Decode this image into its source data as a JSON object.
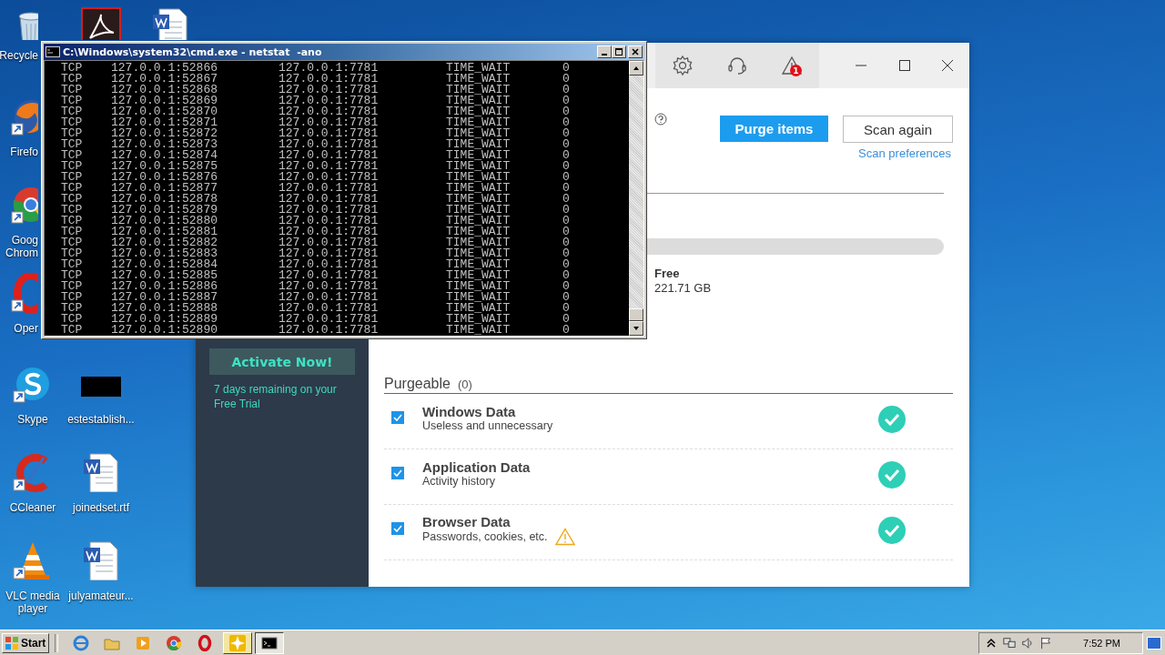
{
  "desktop": {
    "icons": [
      {
        "kind": "recycle",
        "label": "Recycle",
        "shortcut": false
      },
      {
        "kind": "acrobat",
        "shortcut": false
      },
      {
        "kind": "word",
        "shortcut": false
      },
      {
        "kind": "firefox",
        "label": "Firefo",
        "shortcut": true
      },
      {
        "kind": "chrome",
        "label": "Goog Chrom",
        "shortcut": true
      },
      {
        "kind": "opera",
        "label": "Oper",
        "shortcut": true
      },
      {
        "kind": "skype",
        "label": "Skype",
        "shortcut": true
      },
      {
        "kind": "blank",
        "label": "estestablish...",
        "shortcut": false
      },
      {
        "kind": "ccleaner",
        "label": "CCleaner",
        "shortcut": true
      },
      {
        "kind": "word",
        "label": "joinedset.rtf",
        "shortcut": false
      },
      {
        "kind": "vlc",
        "label": "VLC media player",
        "shortcut": true
      },
      {
        "kind": "word",
        "label": "julyamateur...",
        "shortcut": false
      }
    ]
  },
  "app": {
    "toolbar": {
      "alert_badge": "1"
    },
    "purge_button": "Purge items",
    "scan_button": "Scan again",
    "scan_preferences": "Scan preferences",
    "disk": {
      "free_label": "Free",
      "free_value": "221.71 GB"
    },
    "sidebar": {
      "activate_button": "Activate Now!",
      "trial_text": "7 days remaining on your Free Trial"
    },
    "purgeable": {
      "title": "Purgeable",
      "count": "(0)",
      "items": [
        {
          "title": "Windows Data",
          "subtitle": "Useless and unnecessary",
          "checked": true,
          "warning": false,
          "done": true
        },
        {
          "title": "Application Data",
          "subtitle": "Activity history",
          "checked": true,
          "warning": false,
          "done": true
        },
        {
          "title": "Browser Data",
          "subtitle": "Passwords, cookies, etc.",
          "checked": true,
          "warning": true,
          "done": true
        }
      ]
    }
  },
  "cmd": {
    "title": "C:\\Windows\\system32\\cmd.exe - netstat  -ano",
    "rows": [
      {
        "proto": "TCP",
        "local": "127.0.0.1:52866",
        "foreign": "127.0.0.1:7781",
        "state": "TIME_WAIT",
        "pid": "0"
      },
      {
        "proto": "TCP",
        "local": "127.0.0.1:52867",
        "foreign": "127.0.0.1:7781",
        "state": "TIME_WAIT",
        "pid": "0"
      },
      {
        "proto": "TCP",
        "local": "127.0.0.1:52868",
        "foreign": "127.0.0.1:7781",
        "state": "TIME_WAIT",
        "pid": "0"
      },
      {
        "proto": "TCP",
        "local": "127.0.0.1:52869",
        "foreign": "127.0.0.1:7781",
        "state": "TIME_WAIT",
        "pid": "0"
      },
      {
        "proto": "TCP",
        "local": "127.0.0.1:52870",
        "foreign": "127.0.0.1:7781",
        "state": "TIME_WAIT",
        "pid": "0"
      },
      {
        "proto": "TCP",
        "local": "127.0.0.1:52871",
        "foreign": "127.0.0.1:7781",
        "state": "TIME_WAIT",
        "pid": "0"
      },
      {
        "proto": "TCP",
        "local": "127.0.0.1:52872",
        "foreign": "127.0.0.1:7781",
        "state": "TIME_WAIT",
        "pid": "0"
      },
      {
        "proto": "TCP",
        "local": "127.0.0.1:52873",
        "foreign": "127.0.0.1:7781",
        "state": "TIME_WAIT",
        "pid": "0"
      },
      {
        "proto": "TCP",
        "local": "127.0.0.1:52874",
        "foreign": "127.0.0.1:7781",
        "state": "TIME_WAIT",
        "pid": "0"
      },
      {
        "proto": "TCP",
        "local": "127.0.0.1:52875",
        "foreign": "127.0.0.1:7781",
        "state": "TIME_WAIT",
        "pid": "0"
      },
      {
        "proto": "TCP",
        "local": "127.0.0.1:52876",
        "foreign": "127.0.0.1:7781",
        "state": "TIME_WAIT",
        "pid": "0"
      },
      {
        "proto": "TCP",
        "local": "127.0.0.1:52877",
        "foreign": "127.0.0.1:7781",
        "state": "TIME_WAIT",
        "pid": "0"
      },
      {
        "proto": "TCP",
        "local": "127.0.0.1:52878",
        "foreign": "127.0.0.1:7781",
        "state": "TIME_WAIT",
        "pid": "0"
      },
      {
        "proto": "TCP",
        "local": "127.0.0.1:52879",
        "foreign": "127.0.0.1:7781",
        "state": "TIME_WAIT",
        "pid": "0"
      },
      {
        "proto": "TCP",
        "local": "127.0.0.1:52880",
        "foreign": "127.0.0.1:7781",
        "state": "TIME_WAIT",
        "pid": "0"
      },
      {
        "proto": "TCP",
        "local": "127.0.0.1:52881",
        "foreign": "127.0.0.1:7781",
        "state": "TIME_WAIT",
        "pid": "0"
      },
      {
        "proto": "TCP",
        "local": "127.0.0.1:52882",
        "foreign": "127.0.0.1:7781",
        "state": "TIME_WAIT",
        "pid": "0"
      },
      {
        "proto": "TCP",
        "local": "127.0.0.1:52883",
        "foreign": "127.0.0.1:7781",
        "state": "TIME_WAIT",
        "pid": "0"
      },
      {
        "proto": "TCP",
        "local": "127.0.0.1:52884",
        "foreign": "127.0.0.1:7781",
        "state": "TIME_WAIT",
        "pid": "0"
      },
      {
        "proto": "TCP",
        "local": "127.0.0.1:52885",
        "foreign": "127.0.0.1:7781",
        "state": "TIME_WAIT",
        "pid": "0"
      },
      {
        "proto": "TCP",
        "local": "127.0.0.1:52886",
        "foreign": "127.0.0.1:7781",
        "state": "TIME_WAIT",
        "pid": "0"
      },
      {
        "proto": "TCP",
        "local": "127.0.0.1:52887",
        "foreign": "127.0.0.1:7781",
        "state": "TIME_WAIT",
        "pid": "0"
      },
      {
        "proto": "TCP",
        "local": "127.0.0.1:52888",
        "foreign": "127.0.0.1:7781",
        "state": "TIME_WAIT",
        "pid": "0"
      },
      {
        "proto": "TCP",
        "local": "127.0.0.1:52889",
        "foreign": "127.0.0.1:7781",
        "state": "TIME_WAIT",
        "pid": "0"
      },
      {
        "proto": "TCP",
        "local": "127.0.0.1:52890",
        "foreign": "127.0.0.1:7781",
        "state": "TIME_WAIT",
        "pid": "0"
      }
    ]
  },
  "taskbar": {
    "start": "Start",
    "items": [
      {
        "kind": "ie",
        "selected": false
      },
      {
        "kind": "explorer",
        "selected": false
      },
      {
        "kind": "media",
        "selected": false
      },
      {
        "kind": "chrome",
        "selected": false
      },
      {
        "kind": "opera",
        "selected": false
      },
      {
        "kind": "star",
        "selected": false
      },
      {
        "kind": "cmd",
        "selected": true
      }
    ],
    "clock": "7:52 PM"
  }
}
